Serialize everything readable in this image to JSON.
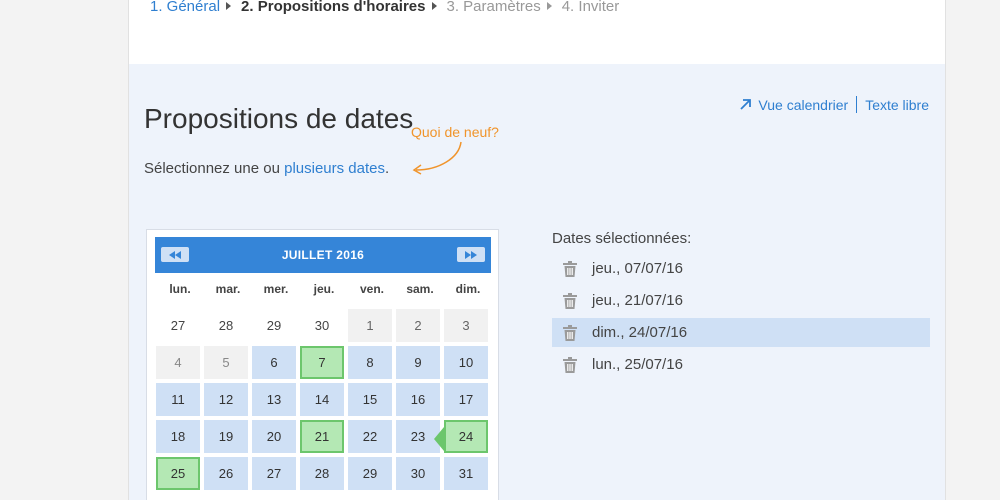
{
  "wizard": {
    "steps": [
      {
        "label": "1. Général",
        "state": "done"
      },
      {
        "label": "2. Propositions d'horaires",
        "state": "current"
      },
      {
        "label": "3. Paramètres",
        "state": "future"
      },
      {
        "label": "4. Inviter",
        "state": "future"
      }
    ]
  },
  "header": {
    "title": "Propositions de dates",
    "hint_prefix": "Sélectionnez une ou ",
    "hint_link": "plusieurs dates",
    "hint_suffix": ".",
    "whats_new": "Quoi de neuf?",
    "view_calendar": "Vue calendrier",
    "free_text": "Texte libre"
  },
  "calendar": {
    "month": "JUILLET",
    "year": "2016",
    "weekdays": [
      "lun.",
      "mar.",
      "mer.",
      "jeu.",
      "ven.",
      "sam.",
      "dim."
    ],
    "weeks": [
      [
        {
          "d": "27",
          "s": "other"
        },
        {
          "d": "28",
          "s": "other"
        },
        {
          "d": "29",
          "s": "other"
        },
        {
          "d": "30",
          "s": "other"
        },
        {
          "d": "1",
          "s": "faded"
        },
        {
          "d": "2",
          "s": "faded"
        },
        {
          "d": "3",
          "s": "faded"
        }
      ],
      [
        {
          "d": "4",
          "s": "faded"
        },
        {
          "d": "5",
          "s": "faded"
        },
        {
          "d": "6",
          "s": "avail"
        },
        {
          "d": "7",
          "s": "sel"
        },
        {
          "d": "8",
          "s": "avail"
        },
        {
          "d": "9",
          "s": "avail"
        },
        {
          "d": "10",
          "s": "avail"
        }
      ],
      [
        {
          "d": "11",
          "s": "avail"
        },
        {
          "d": "12",
          "s": "avail"
        },
        {
          "d": "13",
          "s": "avail"
        },
        {
          "d": "14",
          "s": "avail"
        },
        {
          "d": "15",
          "s": "avail"
        },
        {
          "d": "16",
          "s": "avail"
        },
        {
          "d": "17",
          "s": "avail"
        }
      ],
      [
        {
          "d": "18",
          "s": "avail"
        },
        {
          "d": "19",
          "s": "avail"
        },
        {
          "d": "20",
          "s": "avail"
        },
        {
          "d": "21",
          "s": "sel"
        },
        {
          "d": "22",
          "s": "avail"
        },
        {
          "d": "23",
          "s": "avail"
        },
        {
          "d": "24",
          "s": "sel active"
        }
      ],
      [
        {
          "d": "25",
          "s": "sel"
        },
        {
          "d": "26",
          "s": "avail"
        },
        {
          "d": "27",
          "s": "avail"
        },
        {
          "d": "28",
          "s": "avail"
        },
        {
          "d": "29",
          "s": "avail"
        },
        {
          "d": "30",
          "s": "avail"
        },
        {
          "d": "31",
          "s": "avail"
        }
      ]
    ]
  },
  "selected": {
    "title": "Dates sélectionnées:",
    "items": [
      {
        "label": "jeu., 07/07/16",
        "highlight": false
      },
      {
        "label": "jeu., 21/07/16",
        "highlight": false
      },
      {
        "label": "dim., 24/07/16",
        "highlight": true
      },
      {
        "label": "lun., 25/07/16",
        "highlight": false
      }
    ]
  },
  "colors": {
    "accent": "#3585d8",
    "link": "#2f7fd0",
    "selected_green": "#b4e8b4",
    "available_blue": "#cfe0f5",
    "whats_new_orange": "#f0942b"
  }
}
